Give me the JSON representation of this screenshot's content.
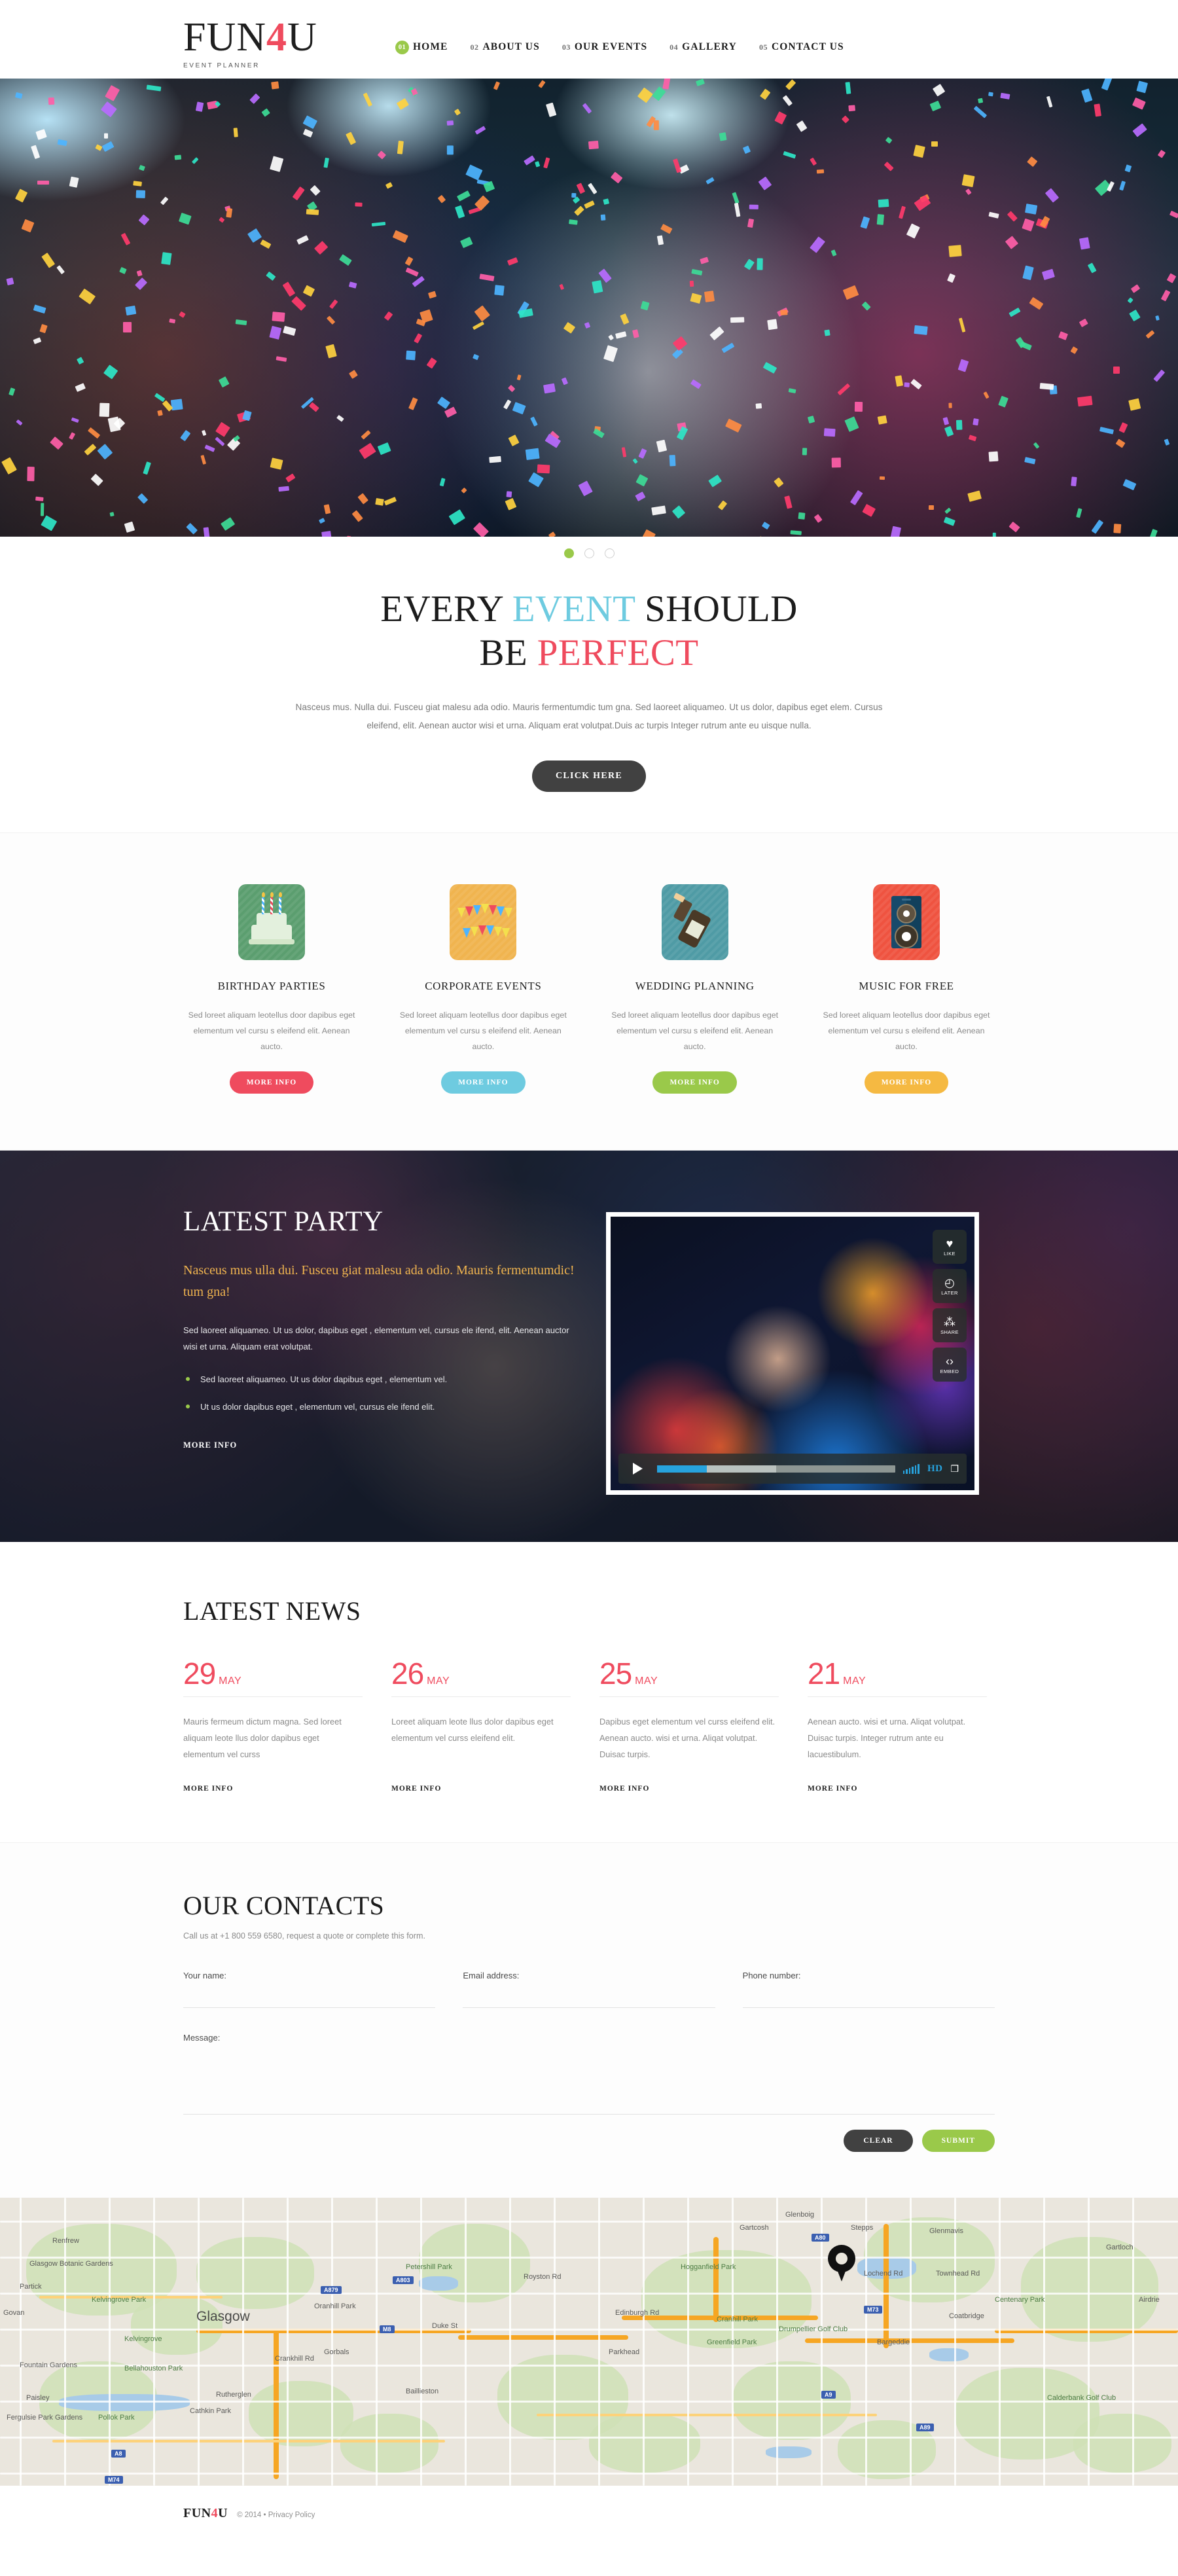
{
  "brand": {
    "name_part1": "FUN",
    "name_accent": "4",
    "name_part2": "U",
    "tagline": "EVENT PLANNER"
  },
  "nav": {
    "items": [
      {
        "num": "01",
        "label": "HOME",
        "active": true
      },
      {
        "num": "02",
        "label": "ABOUT US",
        "active": false
      },
      {
        "num": "03",
        "label": "OUR EVENTS",
        "active": false
      },
      {
        "num": "04",
        "label": "GALLERY",
        "active": false
      },
      {
        "num": "05",
        "label": "CONTACT US",
        "active": false
      }
    ]
  },
  "slider": {
    "slide_count": 3,
    "active_index": 0
  },
  "intro": {
    "title_1": "EVERY",
    "title_accent_blue": "EVENT",
    "title_2": "SHOULD",
    "title_3": "BE",
    "title_accent_red": "PERFECT",
    "paragraph": "Nasceus mus. Nulla dui.  Fusceu giat malesu ada odio. Mauris fermentumdic tum gna.  Sed laoreet aliquameo.  Ut us dolor, dapibus eget  elem.  Cursus eleifend, elit. Aenean auctor wisi et urna. Aliquam erat volutpat.Duis ac turpis Integer rutrum ante eu uisque nulla.",
    "cta_label": "CLICK HERE"
  },
  "services": {
    "items": [
      {
        "title": "BIRTHDAY PARTIES",
        "text": "Sed loreet aliquam leotellus door dapibus eget elementum vel cursu s eleifend elit. Aenean aucto.",
        "button_label": "MORE INFO",
        "icon": "birthday-cake-icon",
        "tile_color": "#5b9e6f",
        "button_color": "#ef4b5e"
      },
      {
        "title": "CORPORATE EVENTS",
        "text": "Sed loreet aliquam leotellus door dapibus eget elementum vel cursu s eleifend elit. Aenean aucto.",
        "button_label": "MORE INFO",
        "icon": "bunting-flags-icon",
        "tile_color": "#f0b44f",
        "button_color": "#6ecbe0"
      },
      {
        "title": "WEDDING PLANNING",
        "text": "Sed loreet aliquam leotellus door dapibus eget elementum vel cursu s eleifend elit. Aenean aucto.",
        "button_label": "MORE INFO",
        "icon": "champagne-bottle-icon",
        "tile_color": "#4f9ba5",
        "button_color": "#9ac94a"
      },
      {
        "title": "MUSIC FOR FREE",
        "text": "Sed loreet aliquam leotellus door dapibus eget elementum vel cursu s eleifend elit. Aenean aucto.",
        "button_label": "MORE INFO",
        "icon": "speaker-icon",
        "tile_color": "#ef5340",
        "button_color": "#f5b942"
      }
    ]
  },
  "party": {
    "title": "LATEST PARTY",
    "lead": "Nasceus mus ulla dui.  Fusceu giat malesu ada odio. Mauris  fermentumdic!  tum gna!",
    "body": "Sed laoreet aliquameo.  Ut us dolor, dapibus eget , elementum vel, cursus ele ifend, elit. Aenean auctor wisi et urna. Aliquam erat volutpat.",
    "bullets": [
      "Sed laoreet aliquameo.  Ut us dolor dapibus eget , elementum vel.",
      "Ut us dolor dapibus eget , elementum vel, cursus ele ifend elit."
    ],
    "more_label": "MORE INFO",
    "video": {
      "side_buttons": [
        {
          "label": "LIKE",
          "icon": "heart-icon",
          "glyph": "♥"
        },
        {
          "label": "LATER",
          "icon": "clock-icon",
          "glyph": "◴"
        },
        {
          "label": "SHARE",
          "icon": "share-icon",
          "glyph": "⁂"
        },
        {
          "label": "EMBED",
          "icon": "code-icon",
          "glyph": "‹›"
        }
      ],
      "play_icon": "play-icon",
      "quality_label": "HD",
      "volume_icon": "volume-icon",
      "fullscreen_icon": "fullscreen-icon",
      "progress_percent": 21,
      "buffered_percent": 50
    }
  },
  "news": {
    "title": "LATEST NEWS",
    "items": [
      {
        "day": "29",
        "month": "MAY",
        "text": "Mauris fermeum dictum magna. Sed loreet aliquam leote llus dolor dapibus eget elementum vel curss",
        "more_label": "MORE INFO"
      },
      {
        "day": "26",
        "month": "MAY",
        "text": "Loreet aliquam leote llus dolor dapibus eget elementum vel curss eleifend elit.",
        "more_label": "MORE INFO"
      },
      {
        "day": "25",
        "month": "MAY",
        "text": "Dapibus eget elementum vel curss eleifend elit.  Aenean aucto. wisi et urna. Aliqat volutpat. Duisac turpis.",
        "more_label": "MORE INFO"
      },
      {
        "day": "21",
        "month": "MAY",
        "text": "Aenean aucto. wisi et urna. Aliqat volutpat. Duisac turpis. Integer rutrum ante eu lacuestibulum.",
        "more_label": "MORE INFO"
      }
    ]
  },
  "contacts": {
    "title": "OUR CONTACTS",
    "subtitle": "Call us at +1 800 559 6580, request a quote or complete this form.",
    "fields": {
      "name_label": "Your name:",
      "name_value": "",
      "email_label": "Email address:",
      "email_value": "",
      "phone_label": "Phone number:",
      "phone_value": "",
      "message_label": "Message:",
      "message_value": ""
    },
    "clear_label": "CLEAR",
    "submit_label": "SUBMIT"
  },
  "map": {
    "marker_icon": "location-pin-icon",
    "labels": [
      "Glasgow",
      "Glasgow Botanic Gardens",
      "Partick",
      "Govan",
      "Paisley",
      "Kelvingrove Park",
      "Petershill Park",
      "Hogganfield Park",
      "Stepps",
      "Royston Rd",
      "Edinburgh Rd",
      "Cranhill Park",
      "Greenfield Park",
      "Gorbals",
      "Duke St",
      "Parkhead",
      "Baillieston",
      "Rutherglen",
      "Coatbridge",
      "Centenary Park",
      "Glenmavis",
      "Glenboig",
      "Gartcosh",
      "Bargeddie",
      "Drumpellier Golf Club",
      "Lochend Rd",
      "Townhead Rd",
      "Cathkin Park",
      "Fountain Gardens",
      "Renfrew",
      "Fergulsie Park Gardens",
      "Bellahouston Park",
      "Pollok Park",
      "Crankhill Rd",
      "Oranhill Park",
      "Kelvingrove",
      "Gartloch",
      "Airdrie",
      "Calderbank Golf Club"
    ],
    "road_shields": [
      "M8",
      "M73",
      "M74",
      "A8",
      "A89",
      "A80",
      "A803",
      "A879",
      "A9"
    ]
  },
  "footer": {
    "logo_part1": "FUN",
    "logo_accent": "4",
    "logo_part2": "U",
    "copyright": "© 2014 •",
    "privacy_label": "Privacy Policy"
  }
}
